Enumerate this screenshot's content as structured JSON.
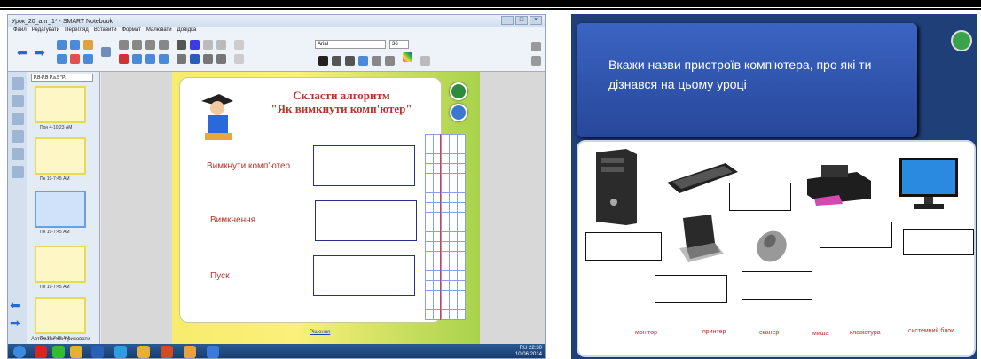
{
  "window": {
    "title": "Урок_20_алг_1* - SMART Notebook",
    "controls": [
      "–",
      "□",
      "×"
    ]
  },
  "menu": [
    "Файл",
    "Редагувати",
    "Перегляд",
    "Вставити",
    "Формат",
    "Малювати",
    "Довідка"
  ],
  "toolbar": {
    "font": "Arial",
    "size": "36"
  },
  "sidebar": {
    "page_selector": "P.B-P.B P.a.5 \"P.",
    "thumb_labels": [
      "Пон 4-10:23 AM",
      "Пн 19-7:45 AM",
      "Пн 19-7:45 AM",
      "Пн 19-7:45 AM",
      "Пн 19-7:45 AM",
      "Пн 19-7:45 AM"
    ],
    "auto_hide": "Автоматично приховати"
  },
  "slide": {
    "title_line1": "Скласти алгоритм",
    "title_line2": "\"Як вимкнути комп'ютер\"",
    "labels": [
      "Вимкнути комп'ютер",
      "Вимкнення",
      "Пуск"
    ],
    "link": "Рішення"
  },
  "taskbar": {
    "lang": "RU",
    "time": "22:30",
    "date": "10.06.2014"
  },
  "right_slide": {
    "instruction": "Вкажи назви пристроїв комп'ютера, про які ти дізнався на цьому уроці",
    "words": [
      "монітор",
      "принтер",
      "сканер",
      "миша",
      "клавіатура",
      "системний блок"
    ]
  },
  "colors": {
    "slide_title": "#b2362b",
    "header_bg": "#3b64c2",
    "word": "#d22a2a"
  }
}
